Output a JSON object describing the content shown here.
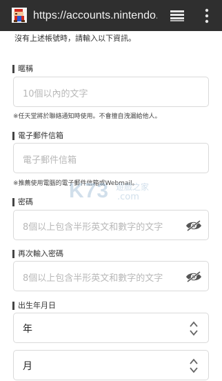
{
  "browser": {
    "url": "https://accounts.nintendo.com",
    "favicon_icon": "mario-icon",
    "tabs_icon": "tabs-stack-icon",
    "menu_icon": "overflow-menu-icon"
  },
  "intro_text": "沒有上述帳號時，請輸入以下資訊。",
  "nickname": {
    "label": "暱稱",
    "placeholder": "10個以內的文字",
    "note": "※任天堂將於聯絡通知時使用。不會擅自洩漏給他人。"
  },
  "email": {
    "label": "電子郵件信箱",
    "placeholder": "電子郵件信箱",
    "note": "※推薦使用電腦的電子郵件信箱或Webmail。"
  },
  "password": {
    "label": "密碼",
    "placeholder": "8個以上包含半形英文和數字的文字",
    "toggle_icon": "eye-icon"
  },
  "password_confirm": {
    "label": "再次輸入密碼",
    "placeholder": "8個以上包含半形英文和數字的文字",
    "toggle_icon": "eye-icon"
  },
  "birthday": {
    "label": "出生年月日",
    "year": "年",
    "month": "月"
  },
  "watermark": {
    "logo": "K73",
    "tagline": "遊戲之家",
    "domain": ".com"
  }
}
